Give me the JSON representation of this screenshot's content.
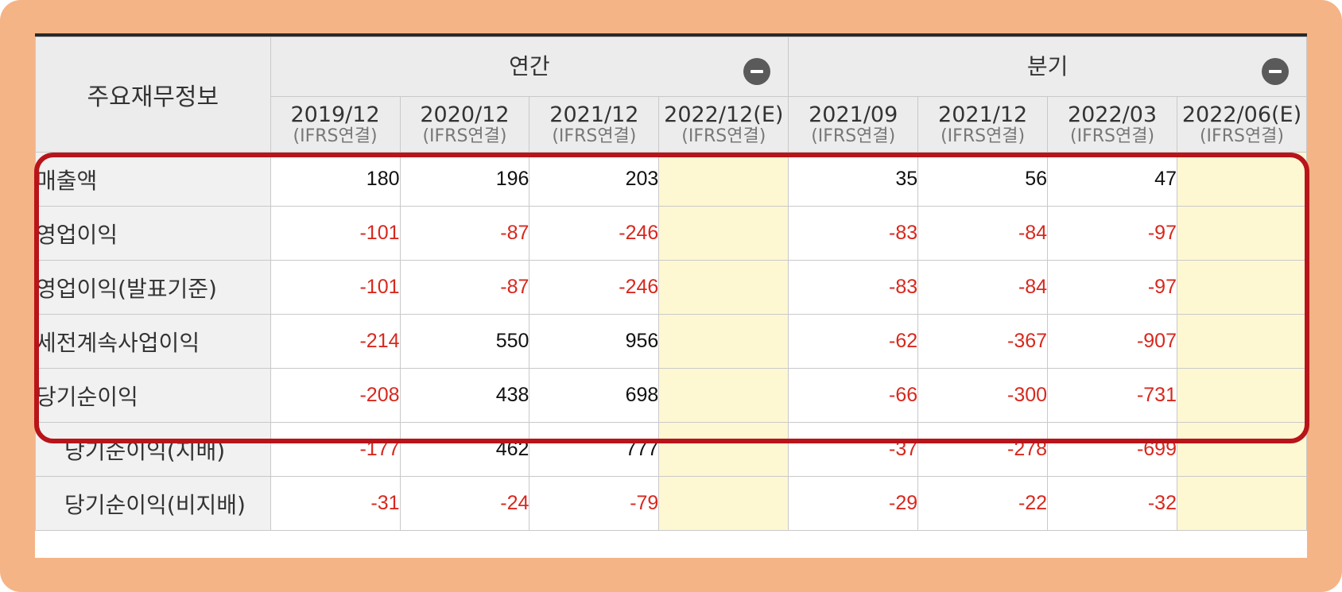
{
  "table": {
    "corner_label": "주요재무정보",
    "groups": [
      {
        "label": "연간"
      },
      {
        "label": "분기"
      }
    ],
    "periods": [
      {
        "date": "2019/12",
        "basis": "(IFRS연결)"
      },
      {
        "date": "2020/12",
        "basis": "(IFRS연결)"
      },
      {
        "date": "2021/12",
        "basis": "(IFRS연결)"
      },
      {
        "date": "2022/12(E)",
        "basis": "(IFRS연결)"
      },
      {
        "date": "2021/09",
        "basis": "(IFRS연결)"
      },
      {
        "date": "2021/12",
        "basis": "(IFRS연결)"
      },
      {
        "date": "2022/03",
        "basis": "(IFRS연결)"
      },
      {
        "date": "2022/06(E)",
        "basis": "(IFRS연결)"
      }
    ],
    "rows": [
      {
        "label": "매출액",
        "values": [
          "180",
          "196",
          "203",
          "",
          "35",
          "56",
          "47",
          ""
        ]
      },
      {
        "label": "영업이익",
        "values": [
          "-101",
          "-87",
          "-246",
          "",
          "-83",
          "-84",
          "-97",
          ""
        ]
      },
      {
        "label": "영업이익(발표기준)",
        "values": [
          "-101",
          "-87",
          "-246",
          "",
          "-83",
          "-84",
          "-97",
          ""
        ]
      },
      {
        "label": "세전계속사업이익",
        "values": [
          "-214",
          "550",
          "956",
          "",
          "-62",
          "-367",
          "-907",
          ""
        ]
      },
      {
        "label": "당기순이익",
        "values": [
          "-208",
          "438",
          "698",
          "",
          "-66",
          "-300",
          "-731",
          ""
        ]
      },
      {
        "label": "당기순이익(지배)",
        "values": [
          "-177",
          "462",
          "777",
          "",
          "-37",
          "-278",
          "-699",
          ""
        ]
      },
      {
        "label": "당기순이익(비지배)",
        "values": [
          "-31",
          "-24",
          "-79",
          "",
          "-29",
          "-22",
          "-32",
          ""
        ]
      }
    ]
  },
  "colors": {
    "frame": "#f5b486",
    "highlight_border": "#b8141a",
    "negative": "#d8281e",
    "estimate_cell": "#fdf8d2",
    "header_bg": "#ececec"
  },
  "icons": {
    "collapse": "minus-circle-icon"
  }
}
